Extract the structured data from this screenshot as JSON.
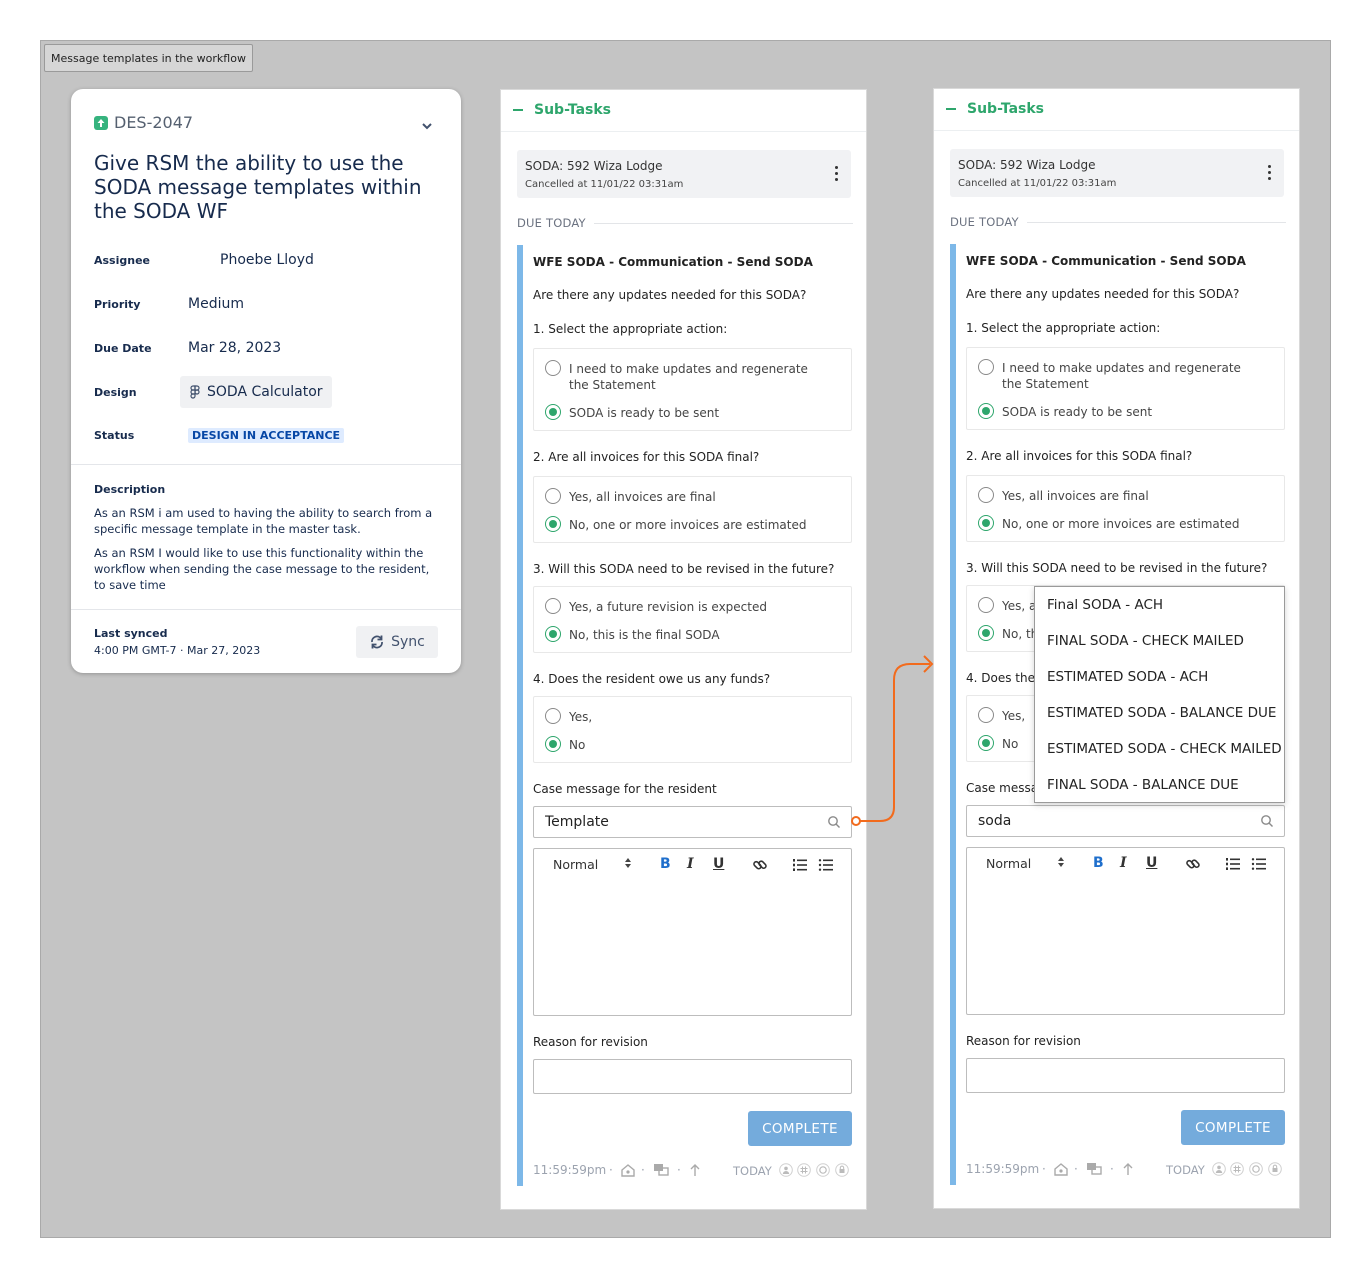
{
  "frame": {
    "label": "Message templates in the workflow"
  },
  "issue": {
    "key": "DES-2047",
    "title": "Give RSM the ability to use the SODA message templates within the SODA WF",
    "fields": {
      "assignee_label": "Assignee",
      "assignee": "Phoebe Lloyd",
      "priority_label": "Priority",
      "priority": "Medium",
      "due_label": "Due Date",
      "due": "Mar 28, 2023",
      "design_label": "Design",
      "design": "SODA Calculator",
      "status_label": "Status",
      "status": "DESIGN IN ACCEPTANCE"
    },
    "description": {
      "title": "Description",
      "p1": "As an RSM i am used to having the ability to search from a specific message template in the master task.",
      "p2": "As an RSM I would like to use this functionality within the workflow when sending the case message to the resident, to save time"
    },
    "sync": {
      "label": "Last synced",
      "value": "4:00 PM GMT-7 · Mar 27, 2023",
      "button": "Sync"
    }
  },
  "panel": {
    "header": "Sub-Tasks",
    "card_title": "SODA: 592 Wiza Lodge",
    "card_sub": "Cancelled at 11/01/22 03:31am",
    "due_today": "DUE TODAY",
    "task_title": "WFE SODA - Communication - Send SODA",
    "intro": "Are there any updates needed for this SODA?",
    "q1": "1. Select the appropriate action:",
    "q1_opt1": "I need to make updates and regenerate the Statement",
    "q1_opt2": "SODA is ready to be sent",
    "q2": "2. Are all invoices for this SODA final?",
    "q2_opt1": "Yes, all invoices are final",
    "q2_opt2": "No, one or more invoices are estimated",
    "q3": "3. Will this SODA need to be revised in the future?",
    "q3_opt1": "Yes, a future revision is expected",
    "q3_opt2": "No, this is the final SODA",
    "q4": "4. Does the resident owe us any funds?",
    "q4_opt1": "Yes,",
    "q4_opt2": "No",
    "case_label": "Case message for the resident",
    "editor_format": "Normal",
    "editor_bold": "B",
    "editor_italic": "I",
    "editor_underline": "U",
    "revision_label": "Reason for revision",
    "complete": "COMPLETE",
    "footer_time": "11:59:59pm",
    "footer_today": "TODAY",
    "left_search_value": "Template",
    "right_search_value": "soda",
    "right_q3_opt1_visible": "Yes, a",
    "right_q3_opt2_visible": "No, th",
    "right_q4_visible": "4. Does the",
    "right_case_label_visible": "Case messag"
  },
  "dropdown": {
    "items": [
      "Final SODA - ACH",
      "FINAL SODA - CHECK MAILED",
      "ESTIMATED SODA - ACH",
      "ESTIMATED SODA - BALANCE DUE",
      "ESTIMATED SODA - CHECK MAILED",
      "FINAL SODA - BALANCE DUE"
    ]
  },
  "colors": {
    "accent_green": "#2ea66c",
    "task_bar_blue": "#7db8e8",
    "complete_blue": "#74abdc",
    "connector_orange": "#f26b1d",
    "status_blue": "#0747a6"
  }
}
